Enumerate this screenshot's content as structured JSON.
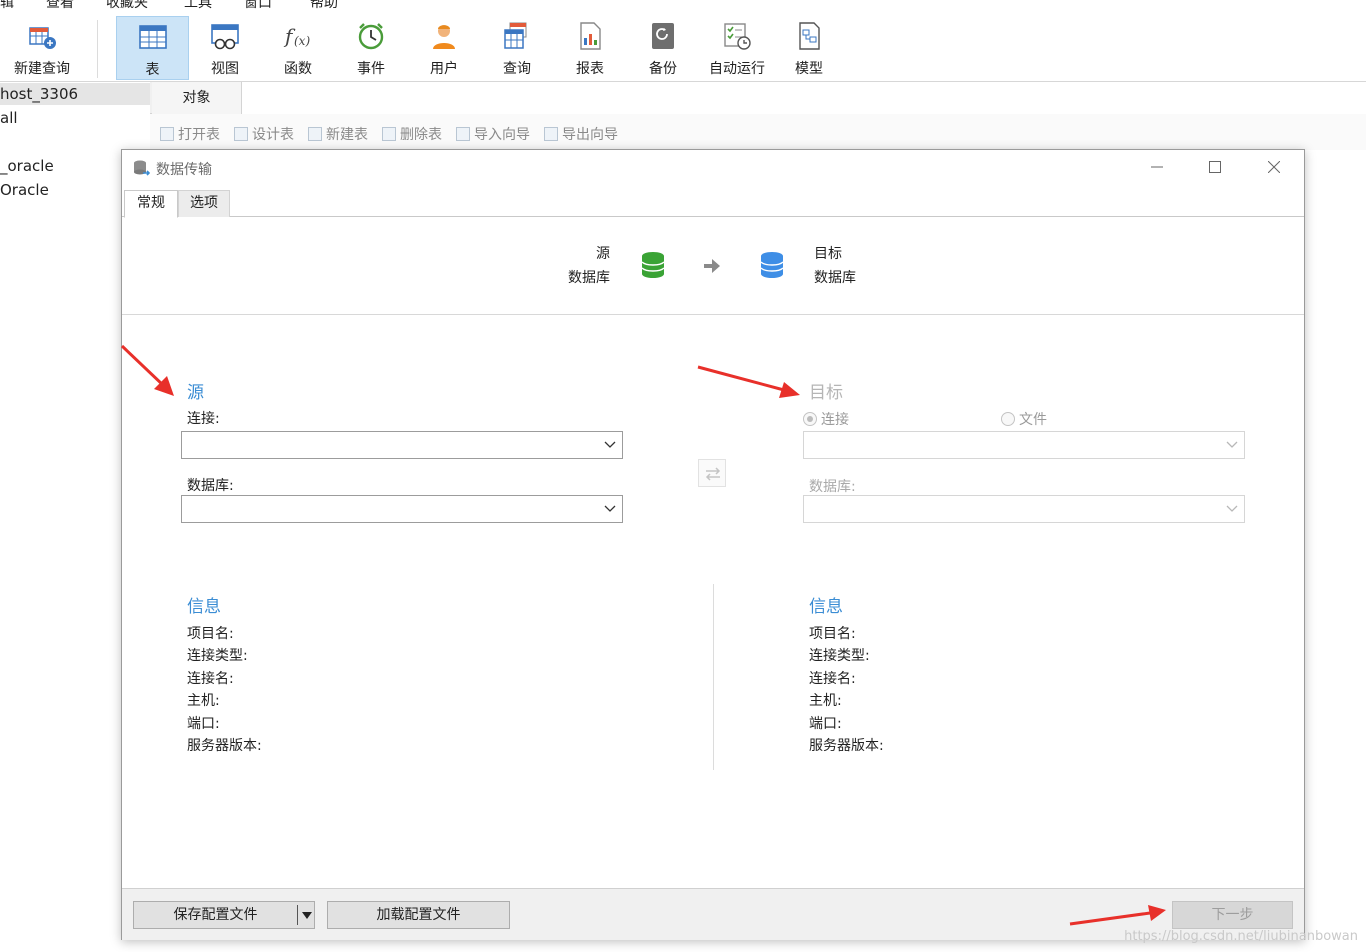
{
  "menu": [
    "辑",
    "查看",
    "收藏夹",
    "工具",
    "窗口",
    "帮助"
  ],
  "toolbar": {
    "items": [
      {
        "label": "新建查询",
        "icon": "new-query-icon"
      },
      {
        "label": "表",
        "icon": "table-icon"
      },
      {
        "label": "视图",
        "icon": "view-icon"
      },
      {
        "label": "函数",
        "icon": "function-icon"
      },
      {
        "label": "事件",
        "icon": "event-clock-icon"
      },
      {
        "label": "用户",
        "icon": "user-icon"
      },
      {
        "label": "查询",
        "icon": "query-icon"
      },
      {
        "label": "报表",
        "icon": "report-icon"
      },
      {
        "label": "备份",
        "icon": "backup-icon"
      },
      {
        "label": "自动运行",
        "icon": "automation-icon"
      },
      {
        "label": "模型",
        "icon": "model-icon"
      }
    ],
    "active": "表"
  },
  "tree": [
    "host_3306",
    "all",
    "_oracle",
    "Oracle"
  ],
  "object_tab": "对象",
  "object_actions": [
    "打开表",
    "设计表",
    "新建表",
    "删除表",
    "导入向导",
    "导出向导"
  ],
  "dialog": {
    "title": "数据传输",
    "tabs": [
      "常规",
      "选项"
    ],
    "flow": {
      "source_line1": "源",
      "source_line2": "数据库",
      "target_line1": "目标",
      "target_line2": "数据库"
    },
    "source": {
      "title": "源",
      "connection_label": "连接:",
      "connection_value": "",
      "database_label": "数据库:",
      "database_value": ""
    },
    "target": {
      "title": "目标",
      "radio_connection": "连接",
      "radio_file": "文件",
      "connection_value": "",
      "database_label": "数据库:",
      "database_value": ""
    },
    "source_info": {
      "title": "信息",
      "fields": [
        "项目名:",
        "连接类型:",
        "连接名:",
        "主机:",
        "端口:",
        "服务器版本:"
      ]
    },
    "target_info": {
      "title": "信息",
      "fields": [
        "项目名:",
        "连接类型:",
        "连接名:",
        "主机:",
        "端口:",
        "服务器版本:"
      ]
    },
    "footer": {
      "save_profile": "保存配置文件",
      "load_profile": "加载配置文件",
      "next": "下一步"
    }
  },
  "watermark": "https://blog.csdn.net/liubinanbowan",
  "colors": {
    "accent": "#3b8dd4",
    "source_db": "#3aa335",
    "target_db": "#3e8ee6",
    "arrow": "#e8302a"
  }
}
